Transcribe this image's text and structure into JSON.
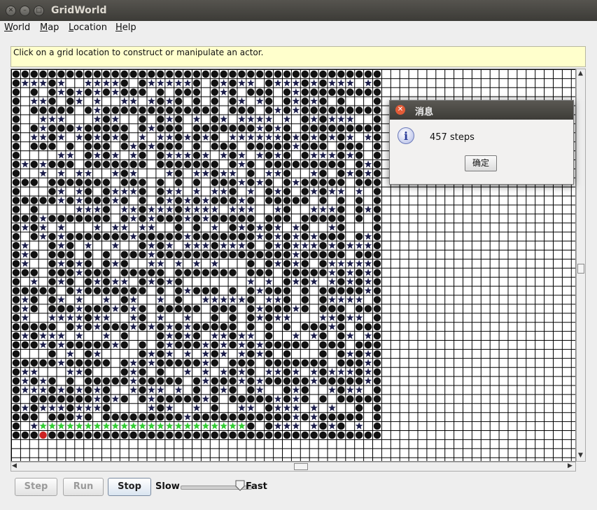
{
  "window": {
    "title": "GridWorld",
    "controls": [
      "close-icon",
      "minimize-icon",
      "maximize-icon"
    ]
  },
  "menu": [
    "World",
    "Map",
    "Location",
    "Help"
  ],
  "message": "Click on a grid location to construct or manipulate an actor.",
  "grid": {
    "background": "#ffffff",
    "line_color": "#000000",
    "rock_color": "#111111",
    "flower_color": "#1b1d4a",
    "bug_color": "#33cc33",
    "red_actor_color": "#cc2222"
  },
  "controls": {
    "step_label": "Step",
    "run_label": "Run",
    "stop_label": "Stop",
    "slow_label": "Slow",
    "fast_label": "Fast",
    "speed_fraction": 0.85
  },
  "dialog": {
    "title": "消息",
    "message": "457 steps",
    "ok_label": "确定",
    "icon": "info-icon"
  }
}
